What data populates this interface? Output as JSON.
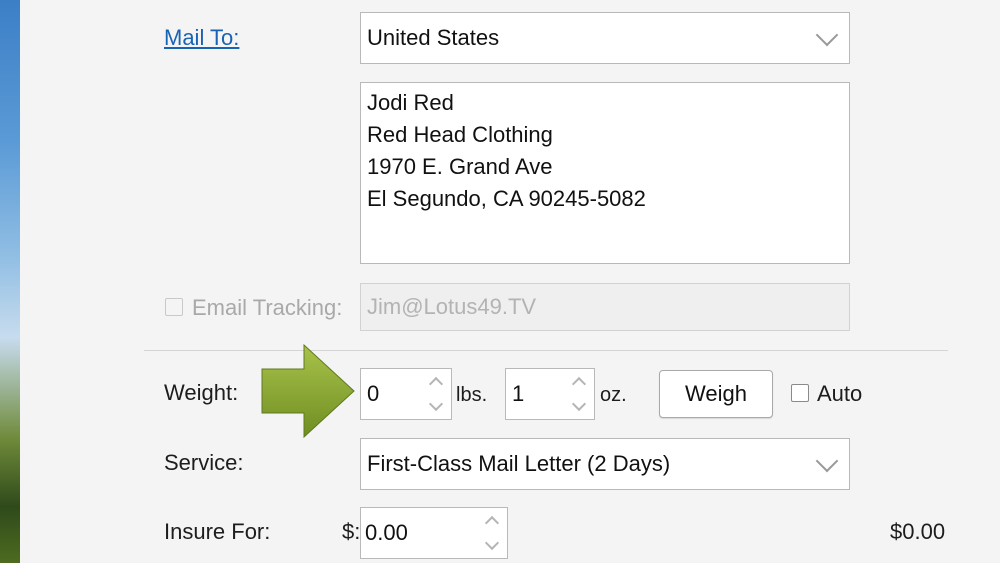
{
  "mail_to": {
    "label": "Mail To:",
    "country": "United States",
    "address_lines": [
      "Jodi Red",
      "Red Head Clothing",
      "1970 E. Grand Ave",
      "El Segundo, CA 90245-5082"
    ]
  },
  "email_tracking": {
    "label": "Email Tracking:",
    "checked": false,
    "value": "Jim@Lotus49.TV"
  },
  "weight": {
    "label": "Weight:",
    "lbs_value": "0",
    "lbs_unit": "lbs.",
    "oz_value": "1",
    "oz_unit": "oz.",
    "weigh_button": "Weigh",
    "auto_label": "Auto",
    "auto_checked": false
  },
  "service": {
    "label": "Service:",
    "selected": "First-Class Mail Letter (2 Days)"
  },
  "insure": {
    "label": "Insure For:",
    "currency": "$:",
    "value": "0.00",
    "cost": "$0.00"
  },
  "colors": {
    "link": "#1a63b4",
    "arrow": "#8aa832"
  }
}
